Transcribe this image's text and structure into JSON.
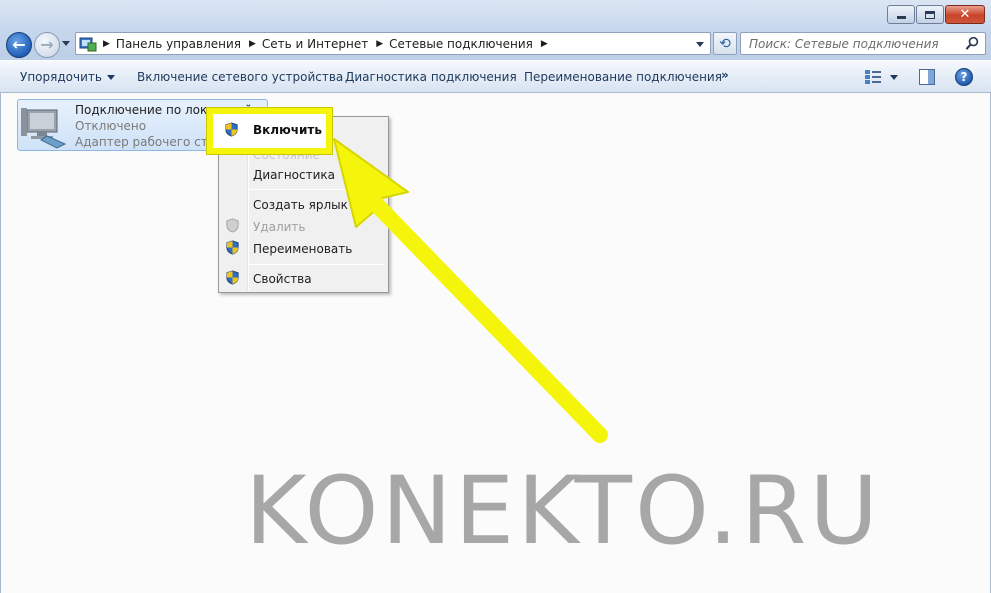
{
  "breadcrumb": {
    "items": [
      "Панель управления",
      "Сеть и Интернет",
      "Сетевые подключения"
    ]
  },
  "search": {
    "placeholder": "Поиск: Сетевые подключения"
  },
  "toolbar": {
    "organize_label": "Упорядочить",
    "enable_device_label": "Включение сетевого устройства",
    "diagnose_label": "Диагностика подключения",
    "rename_label": "Переименование подключения",
    "more_label": "»"
  },
  "connection": {
    "name": "Подключение по локальной сети",
    "status": "Отключено",
    "adapter": "Адаптер рабочего стола"
  },
  "context_menu": {
    "enable": "Включить",
    "status_partial": "Состояние",
    "diagnostics": "Диагностика",
    "create_shortcut": "Создать ярлык",
    "delete": "Удалить",
    "rename": "Переименовать",
    "properties": "Свойства"
  },
  "watermark": "KONEKTO.RU",
  "colors": {
    "highlight": "#f5f50c",
    "arrow": "#f5f50c",
    "accent": "#1f5fb8"
  },
  "icons": {
    "back": "back-arrow-icon",
    "forward": "forward-arrow-icon",
    "refresh": "refresh-icon",
    "search": "search-icon",
    "help": "help-icon",
    "uac_shield": "uac-shield-icon",
    "network_adapter": "network-adapter-icon"
  }
}
